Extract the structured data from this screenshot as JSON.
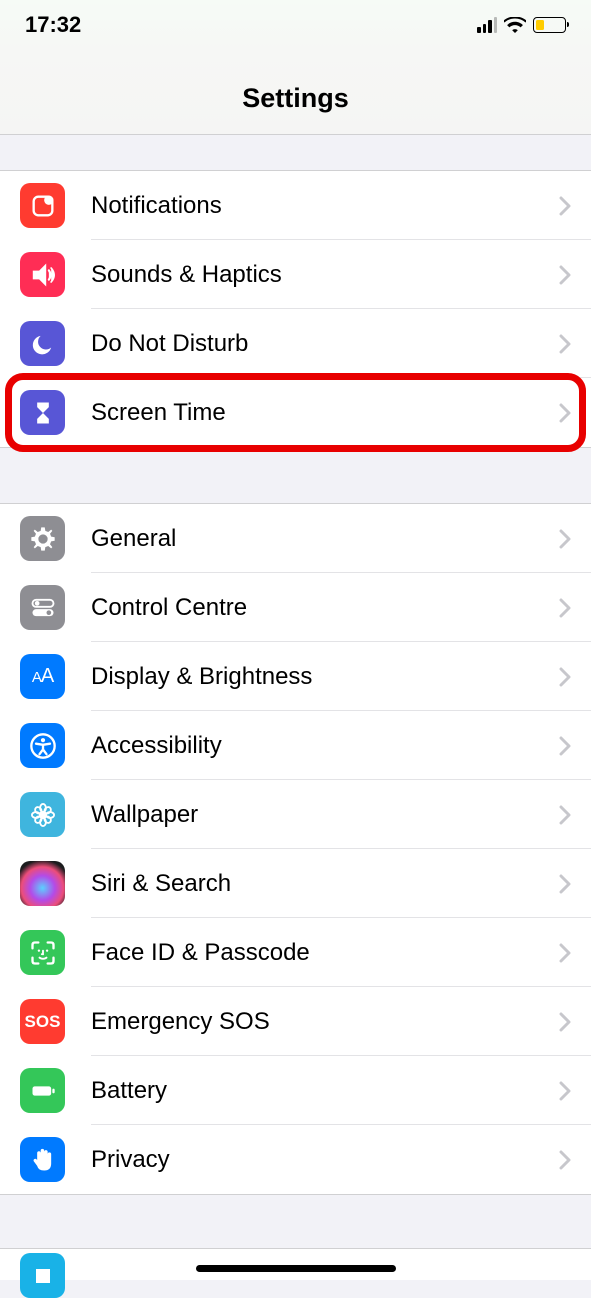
{
  "status": {
    "time": "17:32"
  },
  "header": {
    "title": "Settings"
  },
  "groups": {
    "g1": {
      "notifications": "Notifications",
      "sounds": "Sounds & Haptics",
      "dnd": "Do Not Disturb",
      "screentime": "Screen Time"
    },
    "g2": {
      "general": "General",
      "control": "Control Centre",
      "display": "Display & Brightness",
      "accessibility": "Accessibility",
      "wallpaper": "Wallpaper",
      "siri": "Siri & Search",
      "faceid": "Face ID & Passcode",
      "sos": "Emergency SOS",
      "battery": "Battery",
      "privacy": "Privacy"
    }
  },
  "icon_colors": {
    "notifications": "#ff3b30",
    "sounds": "#ff2d55",
    "dnd": "#5856d6",
    "screentime": "#5856d6",
    "general": "#8e8e93",
    "control": "#8e8e93",
    "display": "#007aff",
    "accessibility": "#007aff",
    "wallpaper": "#3fb5de",
    "siri": "#1c1c1e",
    "faceid": "#34c759",
    "sos": "#ff3b30",
    "battery": "#34c759",
    "privacy": "#007aff",
    "peek": "#19b2e7"
  },
  "sos_text": "SOS"
}
